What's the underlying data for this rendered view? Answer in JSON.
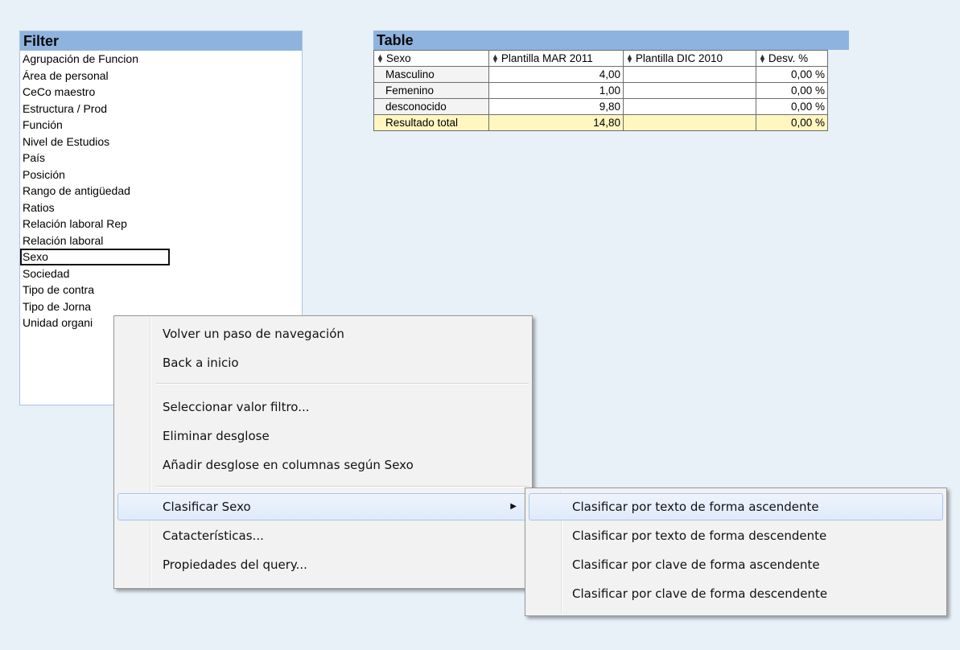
{
  "filter": {
    "title": "Filter",
    "items": [
      "Agrupación de Funcion",
      "Área de personal",
      "CeCo maestro",
      "Estructura / Prod",
      "Función",
      "Nivel de Estudios",
      "País",
      "Posición",
      "Rango de antigüedad",
      "Ratios",
      "Relación laboral Rep",
      "Relación laboral",
      "Sexo",
      "Sociedad",
      "Tipo de contra",
      "Tipo de Jorna",
      "Unidad organi"
    ],
    "selected": "Sexo"
  },
  "table": {
    "title": "Table",
    "columns": [
      "Sexo",
      "Plantilla MAR 2011",
      "Plantilla DIC 2010",
      "Desv. %"
    ],
    "rows": [
      [
        "Masculino",
        "4,00",
        "",
        "0,00 %"
      ],
      [
        "Femenino",
        "1,00",
        "",
        "0,00 %"
      ],
      [
        "desconocido",
        "9,80",
        "",
        "0,00 %"
      ],
      [
        "Resultado total",
        "14,80",
        "",
        "0,00 %"
      ]
    ]
  },
  "context_menu": {
    "items": [
      "Volver un paso de navegación",
      "Back a inicio",
      "Seleccionar valor filtro...",
      "Eliminar desglose",
      "Añadir desglose en columnas según Sexo",
      "Clasificar Sexo",
      "Catacterísticas...",
      "Propiedades del query..."
    ]
  },
  "sub_menu": {
    "items": [
      "Clasificar por texto de forma ascendente",
      "Clasificar por texto de forma descendente",
      "Clasificar por clave de forma ascendente",
      "Clasificar por clave de forma descendente"
    ]
  },
  "colors": {
    "header_bg": "#8fb3df",
    "total_row_bg": "#fff6c0",
    "page_bg": "#e8f0f8"
  }
}
